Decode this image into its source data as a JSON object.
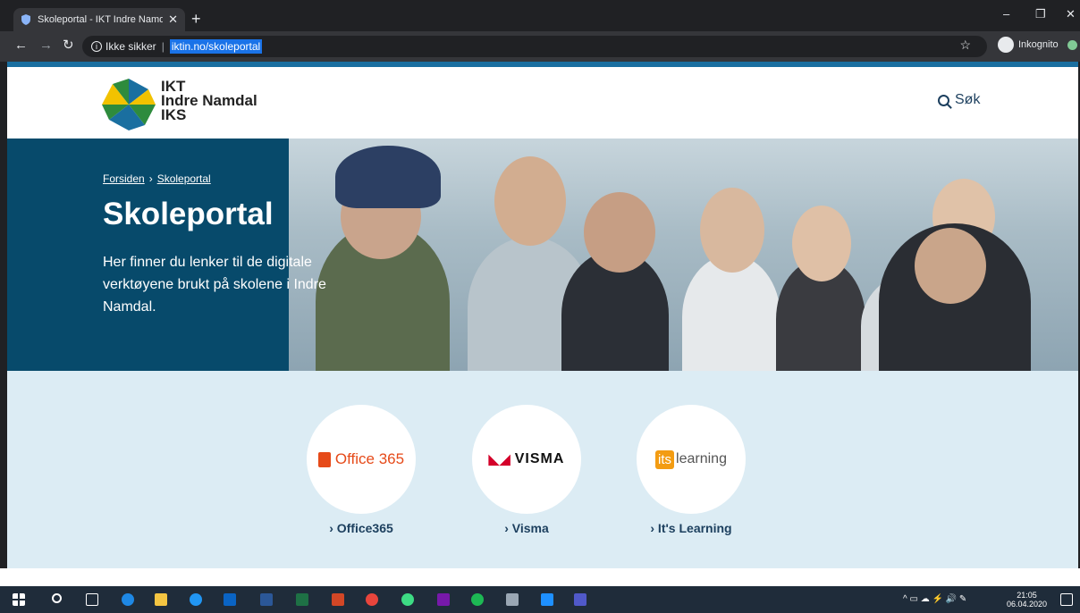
{
  "browser": {
    "tab_title": "Skoleportal - IKT Indre Namdal I",
    "new_tab": "+",
    "security_label": "Ikke sikker",
    "url": "iktin.no/skoleportal",
    "incognito_label": "Inkognito",
    "window_controls": {
      "minimize": "–",
      "restore": "❐",
      "close": "✕"
    }
  },
  "site": {
    "logo_text_lines": [
      "IKT",
      "Indre Namdal",
      "IKS"
    ],
    "search_label": "Søk",
    "breadcrumb": [
      "Forsiden",
      "Skoleportal"
    ],
    "breadcrumb_sep": "›",
    "title": "Skoleportal",
    "intro": "Her finner du lenker til de digitale verktøyene brukt på skolene i Indre Namdal.",
    "links": [
      {
        "logo": "Office 365",
        "label": "› Office365"
      },
      {
        "logo": "VISMA",
        "label": "› Visma"
      },
      {
        "logo_prefix": "its",
        "logo": "learning",
        "label": "› It's Learning"
      }
    ]
  },
  "taskbar": {
    "time": "21:05",
    "date": "06.04.2020"
  },
  "colors": {
    "hero_blue": "#074a6b",
    "link_bg": "#dcecf4",
    "office_orange": "#e64a19",
    "visma_red": "#d4002a",
    "its_orange": "#f39c12"
  }
}
